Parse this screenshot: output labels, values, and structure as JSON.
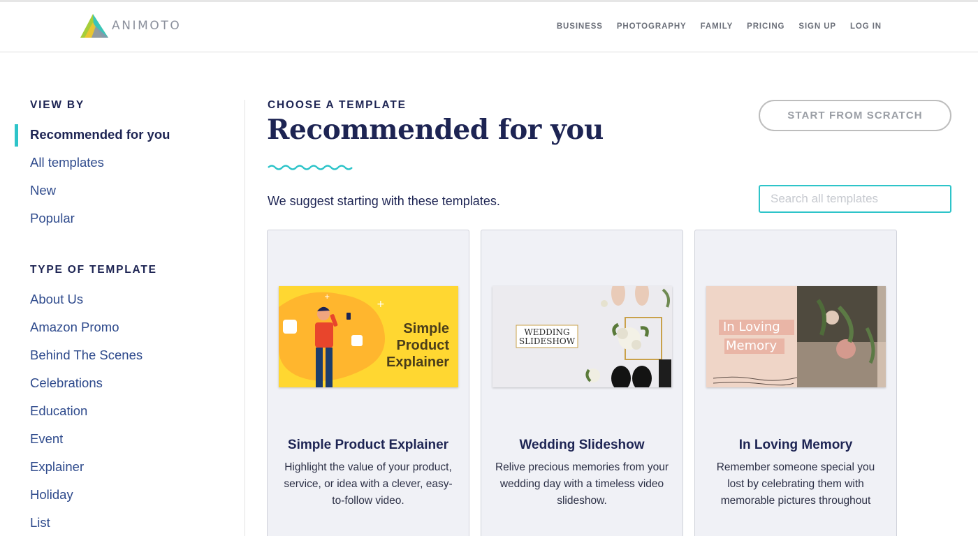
{
  "brand": {
    "name": "ANIMOTO"
  },
  "nav": {
    "items": [
      "BUSINESS",
      "PHOTOGRAPHY",
      "FAMILY",
      "PRICING",
      "SIGN UP",
      "LOG IN"
    ]
  },
  "sidebar": {
    "view_by_heading": "VIEW BY",
    "view_by": [
      "Recommended for you",
      "All templates",
      "New",
      "Popular"
    ],
    "active": "Recommended for you",
    "type_heading": "TYPE OF TEMPLATE",
    "types": [
      "About Us",
      "Amazon Promo",
      "Behind The Scenes",
      "Celebrations",
      "Education",
      "Event",
      "Explainer",
      "Holiday",
      "List"
    ]
  },
  "main": {
    "eyebrow": "CHOOSE A TEMPLATE",
    "title": "Recommended for you",
    "subtitle": "We suggest starting with these templates.",
    "scratch_button": "START FROM SCRATCH",
    "search_placeholder": "Search all templates"
  },
  "cards": [
    {
      "title": "Simple Product Explainer",
      "description": "Highlight the value of your product, service, or idea with a clever, easy-to-follow video.",
      "thumb_text": [
        "Simple",
        "Product",
        "Explainer"
      ]
    },
    {
      "title": "Wedding Slideshow",
      "description": "Relive precious memories from your wedding day with a timeless video slideshow.",
      "thumb_text": [
        "WEDDING",
        "SLIDESHOW"
      ]
    },
    {
      "title": "In Loving Memory",
      "description": "Remember someone special you lost by celebrating them with memorable pictures throughout",
      "thumb_text": [
        "In Loving",
        "Memory"
      ]
    }
  ],
  "colors": {
    "accent": "#2ec4c9",
    "navy": "#1d2453",
    "link": "#2e4a8c",
    "card_bg": "#f0f1f6"
  }
}
